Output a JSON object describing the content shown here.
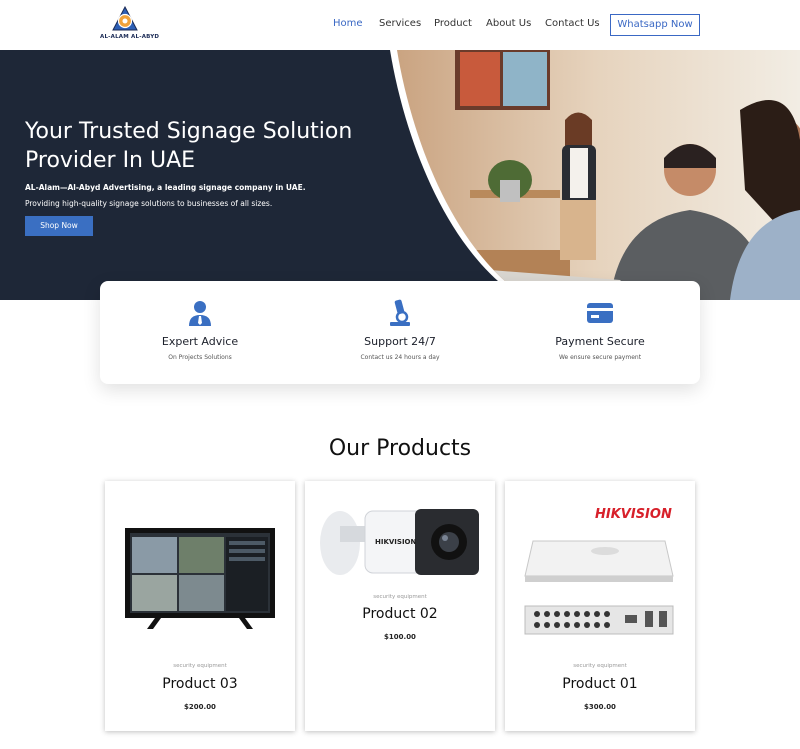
{
  "header": {
    "logo_text": "AL-ALAM AL-ABYD",
    "nav": [
      {
        "label": "Home",
        "active": true
      },
      {
        "label": "Services",
        "active": false
      },
      {
        "label": "Product",
        "active": false
      },
      {
        "label": "About Us",
        "active": false
      },
      {
        "label": "Contact Us",
        "active": false
      }
    ],
    "cta_label": "Whatsapp Now"
  },
  "hero": {
    "title": "Your Trusted Signage Solution Provider In UAE",
    "subtitle_bold": "AL-Alam—Al-Abyd Advertising, a leading signage company in UAE.",
    "subtitle": "Providing high-quality signage solutions to businesses of all sizes.",
    "button_label": "Shop Now"
  },
  "features": [
    {
      "icon": "user-tie-icon",
      "title": "Expert Advice",
      "desc": "On Projects Solutions"
    },
    {
      "icon": "microscope-icon",
      "title": "Support 24/7",
      "desc": "Contact us 24 hours a day"
    },
    {
      "icon": "credit-card-icon",
      "title": "Payment Secure",
      "desc": "We ensure secure payment"
    }
  ],
  "products": {
    "heading": "Our Products",
    "items": [
      {
        "category": "security equipment",
        "name": "Product 03",
        "price": "$200.00",
        "image": "cctv-monitor"
      },
      {
        "category": "security equipment",
        "name": "Product 02",
        "price": "$100.00",
        "image": "bullet-camera",
        "brand": "HIKVISION"
      },
      {
        "category": "security equipment",
        "name": "Product 01",
        "price": "$300.00",
        "image": "dvr-recorder",
        "brand": "HIKVISION"
      }
    ]
  },
  "colors": {
    "accent": "#3a68c4",
    "hero_bg": "#1e2737",
    "brand_red": "#d7202a"
  }
}
